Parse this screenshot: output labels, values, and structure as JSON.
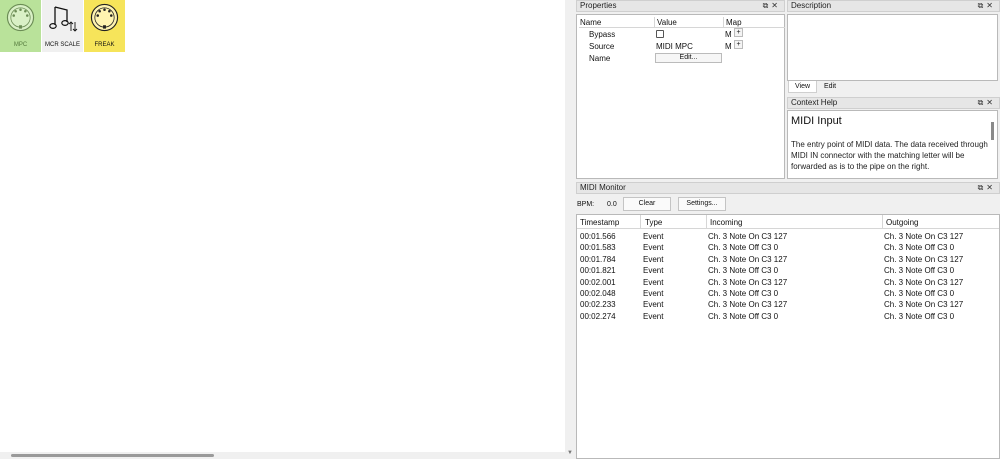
{
  "canvas": {
    "nodes": [
      {
        "label": "MPC",
        "icon": "din-connector-icon",
        "color": "#b9e29a"
      },
      {
        "label": "MCR SCALE",
        "icon": "music-note-icon",
        "color": "#f0f0f0"
      },
      {
        "label": "FREAK",
        "icon": "din-connector-icon",
        "color": "#f6e45a"
      }
    ]
  },
  "properties": {
    "title": "Properties",
    "headers": {
      "name": "Name",
      "value": "Value",
      "map": "Map"
    },
    "rows": {
      "bypass": {
        "name": "Bypass",
        "map": "M",
        "add": "+"
      },
      "source": {
        "name": "Source",
        "value": "MIDI MPC",
        "map": "M",
        "add": "+"
      },
      "name": {
        "name": "Name",
        "button": "Edit..."
      }
    }
  },
  "description": {
    "title": "Description",
    "tabs": {
      "view": "View",
      "edit": "Edit"
    }
  },
  "context_help": {
    "title": "Context Help",
    "heading": "MIDI Input",
    "text": "The entry point of MIDI data. The data received through MIDI IN connector with the matching letter will be forwarded as is to the pipe on the right."
  },
  "midi_monitor": {
    "title": "MIDI Monitor",
    "bpm_label": "BPM:",
    "bpm_value": "0.0",
    "clear_label": "Clear",
    "settings_label": "Settings...",
    "columns": {
      "timestamp": "Timestamp",
      "type": "Type",
      "incoming": "Incoming",
      "outgoing": "Outgoing"
    },
    "rows": [
      {
        "timestamp": "00:01.566",
        "type": "Event",
        "incoming": "Ch. 3 Note On C3 127",
        "outgoing": "Ch. 3 Note On C3 127"
      },
      {
        "timestamp": "00:01.583",
        "type": "Event",
        "incoming": "Ch. 3 Note Off C3 0",
        "outgoing": "Ch. 3 Note Off C3 0"
      },
      {
        "timestamp": "00:01.784",
        "type": "Event",
        "incoming": "Ch. 3 Note On C3 127",
        "outgoing": "Ch. 3 Note On C3 127"
      },
      {
        "timestamp": "00:01.821",
        "type": "Event",
        "incoming": "Ch. 3 Note Off C3 0",
        "outgoing": "Ch. 3 Note Off C3 0"
      },
      {
        "timestamp": "00:02.001",
        "type": "Event",
        "incoming": "Ch. 3 Note On C3 127",
        "outgoing": "Ch. 3 Note On C3 127"
      },
      {
        "timestamp": "00:02.048",
        "type": "Event",
        "incoming": "Ch. 3 Note Off C3 0",
        "outgoing": "Ch. 3 Note Off C3 0"
      },
      {
        "timestamp": "00:02.233",
        "type": "Event",
        "incoming": "Ch. 3 Note On C3 127",
        "outgoing": "Ch. 3 Note On C3 127"
      },
      {
        "timestamp": "00:02.274",
        "type": "Event",
        "incoming": "Ch. 3 Note Off C3 0",
        "outgoing": "Ch. 3 Note Off C3 0"
      }
    ]
  },
  "panel_buttons": {
    "float": "⧉",
    "close": "✕"
  }
}
